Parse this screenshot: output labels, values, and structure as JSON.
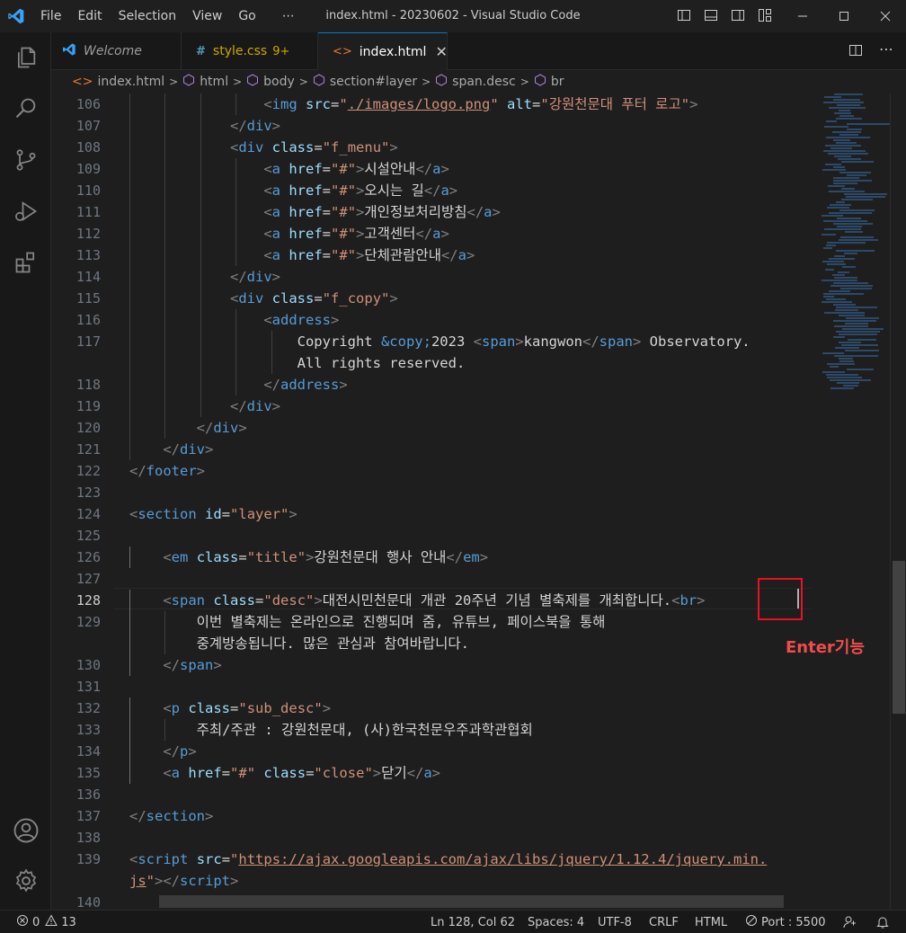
{
  "window": {
    "title": "index.html - 20230602 - Visual Studio Code",
    "menu": [
      "File",
      "Edit",
      "Selection",
      "View",
      "Go",
      "⋯"
    ]
  },
  "tabs": [
    {
      "label": "Welcome",
      "icon": "vscode-icon",
      "active": false,
      "modified": ""
    },
    {
      "label": "style.css",
      "icon": "css-icon",
      "active": false,
      "modified": "9+"
    },
    {
      "label": "index.html",
      "icon": "html-icon",
      "active": true,
      "modified": ""
    }
  ],
  "breadcrumb": [
    "index.html",
    "html",
    "body",
    "section#layer",
    "span.desc",
    "br"
  ],
  "editor": {
    "lines": [
      {
        "n": "106",
        "indent": 4
      },
      {
        "n": "107",
        "indent": 3
      },
      {
        "n": "108",
        "indent": 3
      },
      {
        "n": "109",
        "indent": 4
      },
      {
        "n": "110",
        "indent": 4
      },
      {
        "n": "111",
        "indent": 4
      },
      {
        "n": "112",
        "indent": 4
      },
      {
        "n": "113",
        "indent": 4
      },
      {
        "n": "114",
        "indent": 3
      },
      {
        "n": "115",
        "indent": 3
      },
      {
        "n": "116",
        "indent": 4
      },
      {
        "n": "117",
        "indent": 5
      },
      {
        "n": "",
        "indent": 5
      },
      {
        "n": "118",
        "indent": 4
      },
      {
        "n": "119",
        "indent": 3
      },
      {
        "n": "120",
        "indent": 2
      },
      {
        "n": "121",
        "indent": 1
      },
      {
        "n": "122",
        "indent": 0
      },
      {
        "n": "123",
        "indent": 0
      },
      {
        "n": "124",
        "indent": 0
      },
      {
        "n": "125",
        "indent": 0
      },
      {
        "n": "126",
        "indent": 1
      },
      {
        "n": "127",
        "indent": 0
      },
      {
        "n": "128",
        "indent": 1
      },
      {
        "n": "129",
        "indent": 2
      },
      {
        "n": "",
        "indent": 2
      },
      {
        "n": "130",
        "indent": 1
      },
      {
        "n": "131",
        "indent": 0
      },
      {
        "n": "132",
        "indent": 1
      },
      {
        "n": "133",
        "indent": 2
      },
      {
        "n": "134",
        "indent": 1
      },
      {
        "n": "135",
        "indent": 1
      },
      {
        "n": "136",
        "indent": 0
      },
      {
        "n": "137",
        "indent": 0
      },
      {
        "n": "138",
        "indent": 0
      },
      {
        "n": "139",
        "indent": 0
      },
      {
        "n": "",
        "indent": 0
      },
      {
        "n": "140",
        "indent": 0
      }
    ],
    "code": {
      "l106": {
        "tag": "img",
        "a1": "src",
        "v1": "./images/logo.png",
        "a2": "alt",
        "v2": "강원천문대 푸터 로고"
      },
      "l107": "div",
      "l108": {
        "tag": "div",
        "a": "class",
        "v": "f_menu"
      },
      "l109": {
        "tag": "a",
        "a": "href",
        "v": "#",
        "text": "시설안내"
      },
      "l110": {
        "tag": "a",
        "a": "href",
        "v": "#",
        "text": "오시는 길"
      },
      "l111": {
        "tag": "a",
        "a": "href",
        "v": "#",
        "text": "개인정보처리방침"
      },
      "l112": {
        "tag": "a",
        "a": "href",
        "v": "#",
        "text": "고객센터"
      },
      "l113": {
        "tag": "a",
        "a": "href",
        "v": "#",
        "text": "단체관람안내"
      },
      "l114": "div",
      "l115": {
        "tag": "div",
        "a": "class",
        "v": "f_copy"
      },
      "l116": "address",
      "l117": {
        "text1": "Copyright ",
        "entity": "&copy;",
        "text2": "2023 ",
        "span": "span",
        "inner": "kangwon",
        "text3": " Observatory."
      },
      "l117b": "All rights reserved.",
      "l118": "address",
      "l119": "div",
      "l120": "div",
      "l121": "div",
      "l122": "footer",
      "l124": {
        "tag": "section",
        "a": "id",
        "v": "layer"
      },
      "l126": {
        "tag": "em",
        "a": "class",
        "v": "title",
        "text": "강원천문대 행사 안내"
      },
      "l128": {
        "tag": "span",
        "a": "class",
        "v": "desc",
        "text": "대전시민천문대 개관 20주년 기념 별축제를 개최합니다.",
        "br": "br"
      },
      "l129": "이번 별축제는 온라인으로 진행되며 줌, 유튜브, 페이스북을 통해",
      "l129b": "중계방송됩니다. 많은 관심과 참여바랍니다.",
      "l130": "span",
      "l132": {
        "tag": "p",
        "a": "class",
        "v": "sub_desc"
      },
      "l133": "주최/주관 : 강원천문대, (사)한국천문우주과학관협회",
      "l134": "p",
      "l135": {
        "tag": "a",
        "a1": "href",
        "v1": "#",
        "a2": "class",
        "v2": "close",
        "text": "닫기"
      },
      "l137": "section",
      "l139": {
        "tag": "script",
        "a": "src",
        "v1": "https://ajax.googleapis.com/ajax/libs/jquery/1.12.4/jquery.min.",
        "v2": "js"
      }
    }
  },
  "annotation": {
    "label": "Enter기능",
    "color": "#e81123"
  },
  "statusbar": {
    "errors": "0",
    "warnings": "13",
    "position": "Ln 128, Col 62",
    "spaces": "Spaces: 4",
    "encoding": "UTF-8",
    "eol": "CRLF",
    "language": "HTML",
    "port": "Port : 5500"
  }
}
